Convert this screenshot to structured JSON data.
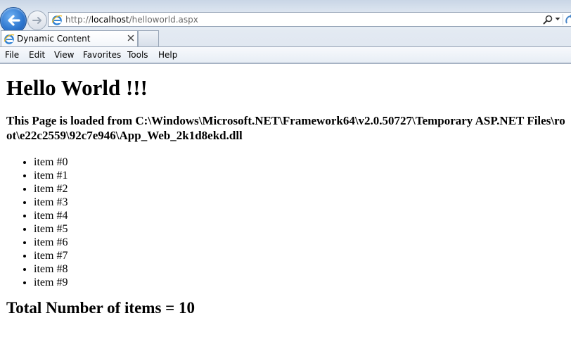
{
  "browser": {
    "address": {
      "prefix": "http://",
      "host": "localhost",
      "path": "/helloworld.aspx"
    },
    "tab": {
      "title": "Dynamic Content"
    },
    "menu": [
      "File",
      "Edit",
      "View",
      "Favorites",
      "Tools",
      "Help"
    ]
  },
  "page": {
    "heading": "Hello World !!!",
    "loaded_from": "This Page is loaded from C:\\Windows\\Microsoft.NET\\Framework64\\v2.0.50727\\Temporary ASP.NET Files\\root\\e22c2559\\92c7e946\\App_Web_2k1d8ekd.dll",
    "items": [
      "item #0",
      "item #1",
      "item #2",
      "item #3",
      "item #4",
      "item #5",
      "item #6",
      "item #7",
      "item #8",
      "item #9"
    ],
    "total": "Total Number of items = 10"
  },
  "colors": {
    "accent": "#2f78d0",
    "chrome_bg": "#dde5ef"
  },
  "icons": {
    "back": "back-arrow-icon",
    "forward": "forward-arrow-icon",
    "ie": "ie-logo-icon",
    "search": "search-icon",
    "close": "close-icon"
  }
}
